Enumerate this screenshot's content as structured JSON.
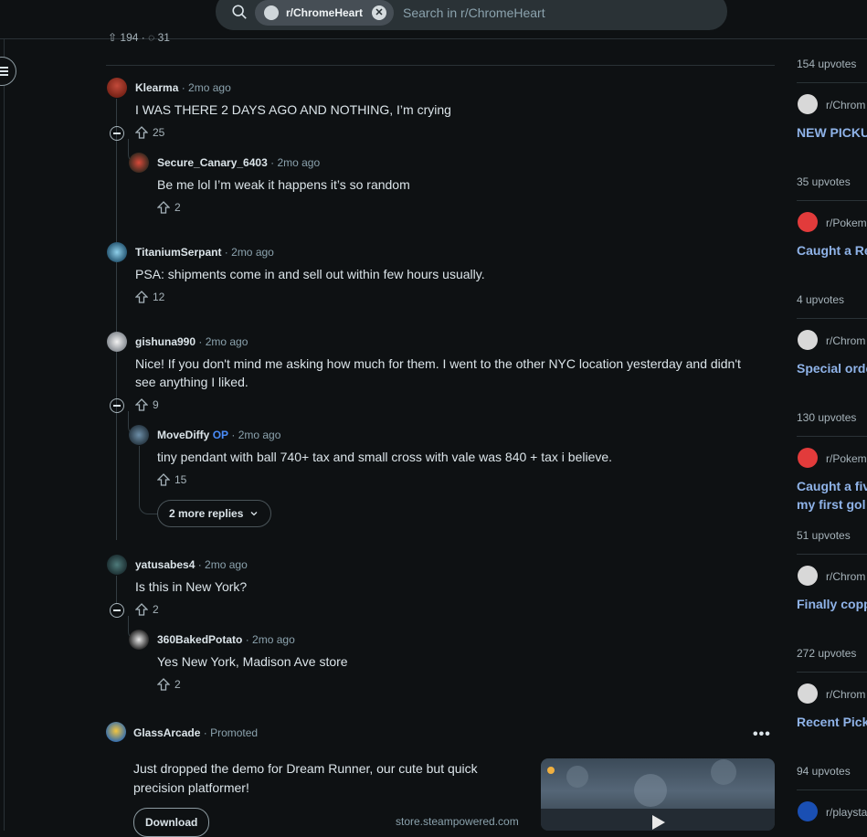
{
  "search": {
    "community_chip": "r/ChromeHeart",
    "placeholder": "Search in r/ChromeHeart"
  },
  "previous_post": {
    "votes": "194",
    "comments": "31"
  },
  "comments": [
    {
      "author": "Klearma",
      "time": "2mo ago",
      "text": "I WAS THERE 2 DAYS AGO AND NOTHING, I’m crying",
      "votes": "25"
    },
    {
      "author": "Secure_Canary_6403",
      "time": "2mo ago",
      "text": "Be me lol I’m weak it happens it’s so random",
      "votes": "2"
    },
    {
      "author": "TitaniumSerpant",
      "time": "2mo ago",
      "text": "PSA: shipments come in and sell out within few hours usually.",
      "votes": "12"
    },
    {
      "author": "gishuna990",
      "time": "2mo ago",
      "text": "Nice! If you don't mind me asking how much for them. I went to the other NYC location yesterday and didn't see anything I liked.",
      "votes": "9"
    },
    {
      "author": "MoveDiffy",
      "badge": "OP",
      "time": "2mo ago",
      "text": "tiny pendant with ball 740+ tax and small cross with vale was 840 + tax i believe.",
      "votes": "15"
    },
    {
      "author": "yatusabes4",
      "time": "2mo ago",
      "text": "Is this in New York?",
      "votes": "2"
    },
    {
      "author": "360BakedPotato",
      "time": "2mo ago",
      "text": "Yes New York, Madison Ave store",
      "votes": "2"
    }
  ],
  "more_replies": "2 more replies",
  "ad": {
    "advertiser": "GlassArcade",
    "label": "Promoted",
    "text": "Just dropped the demo for Dream Runner, our cute but quick precision platformer!",
    "button": "Download",
    "domain": "store.steampowered.com"
  },
  "sidebar": [
    {
      "upvotes": "154 upvotes",
      "sub": "r/Chrom",
      "title": "NEW PICKU",
      "color": "#d8d8d8"
    },
    {
      "upvotes": "35 upvotes",
      "sub": "r/Pokem",
      "title": "Caught a Re",
      "color": "#e23b3b"
    },
    {
      "upvotes": "4 upvotes",
      "sub": "r/Chrom",
      "title": "Special orde",
      "color": "#d8d8d8"
    },
    {
      "upvotes": "130 upvotes",
      "sub": "r/Pokem",
      "title": "Caught a fiv",
      "title2": "my first gol",
      "color": "#e23b3b"
    },
    {
      "upvotes": "51 upvotes",
      "sub": "r/Chrom",
      "title": "Finally copp",
      "color": "#d8d8d8"
    },
    {
      "upvotes": "272 upvotes",
      "sub": "r/Chrom",
      "title": "Recent Pick",
      "color": "#d8d8d8"
    },
    {
      "upvotes": "94 upvotes",
      "sub": "r/playsta",
      "title": "",
      "color": "#1a4fb3"
    }
  ]
}
